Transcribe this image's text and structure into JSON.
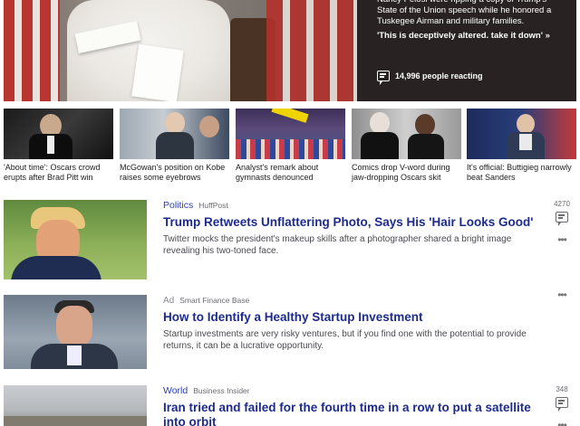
{
  "hero": {
    "description": "Nancy Pelosi were ripping a copy of Trump's State of the Union speech while he honored a Tuskegee Airman and military families.",
    "quote": "'This is deceptively altered. take it down' »",
    "reactions": "14,996 people reacting",
    "icon": "chat-icon"
  },
  "thumbnails": [
    {
      "caption": "'About time': Oscars crowd erupts after Brad Pitt win"
    },
    {
      "caption": "McGowan's position on Kobe raises some eyebrows"
    },
    {
      "caption": "Analyst's remark about gymnasts denounced"
    },
    {
      "caption": "Comics drop V-word during jaw-dropping Oscars skit"
    },
    {
      "caption": "It's official: Buttigieg narrowly beat Sanders"
    }
  ],
  "articles": [
    {
      "category": "Politics",
      "source": "HuffPost",
      "headline": "Trump Retweets Unflattering Photo, Says His 'Hair Looks Good'",
      "summary": "Twitter mocks the president's makeup skills after a photographer shared a bright image revealing his two-toned face.",
      "count": "4270"
    },
    {
      "category": "Ad",
      "source": "Smart Finance Base",
      "headline": "How to Identify a Healthy Startup Investment",
      "summary": "Startup investments are very risky ventures, but if you find one with the potential to provide returns, it can be a lucrative opportunity.",
      "count": ""
    },
    {
      "category": "World",
      "source": "Business Insider",
      "headline": "Iran tried and failed for the fourth time in a row to put a satellite into orbit",
      "summary": "",
      "count": "348"
    }
  ],
  "colors": {
    "category": "#2d3eaf",
    "headline": "#1c2b8c"
  }
}
